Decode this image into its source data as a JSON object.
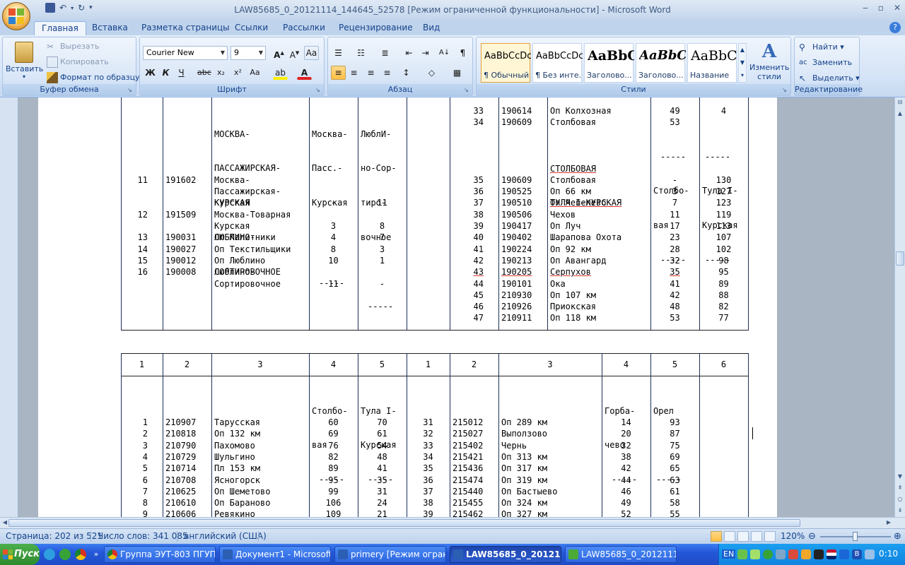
{
  "window": {
    "title": "LAW85685_0_20121114_144645_52578 [Режим ограниченной функциональности] - Microsoft Word"
  },
  "ribbon": {
    "tabs": [
      "Главная",
      "Вставка",
      "Разметка страницы",
      "Ссылки",
      "Рассылки",
      "Рецензирование",
      "Вид"
    ],
    "clipboard": {
      "paste": "Вставить",
      "cut": "Вырезать",
      "copy": "Копировать",
      "format_painter": "Формат по образцу",
      "label": "Буфер обмена"
    },
    "font": {
      "name": "Courier New",
      "size": "9",
      "label": "Шрифт"
    },
    "paragraph": {
      "label": "Абзац"
    },
    "styles": {
      "items": [
        {
          "sample": "AaBbCcDc",
          "name": "¶ Обычный"
        },
        {
          "sample": "AaBbCcDc",
          "name": "¶ Без инте..."
        },
        {
          "sample": "AaBbC",
          "name": "Заголово..."
        },
        {
          "sample": "AaBbCc",
          "name": "Заголово..."
        },
        {
          "sample": "AaBbC",
          "name": "Название"
        }
      ],
      "change": "Изменить стили",
      "label": "Стили"
    },
    "editing": {
      "find": "Найти",
      "replace": "Заменить",
      "select": "Выделить",
      "label": "Редактирование"
    }
  },
  "document": {
    "top_table": {
      "left_header": [
        "МОСКВА-",
        "ПАССАЖИРСКАЯ-",
        "КУРСКАЯ",
        "ЛЮБЛИНО-",
        "СОРТИРОВОЧНОЕ"
      ],
      "left_col4_header": [
        "Москва-",
        "Пасс.-",
        "Курская",
        "",
        "",
        "-----"
      ],
      "left_col5_header": [
        "ЛюблИ-",
        "но-Сор-",
        "тиро-",
        "вочное",
        "",
        "-----"
      ],
      "left_rows": [
        {
          "n": "11",
          "code": "191602",
          "name": [
            "Москва-",
            "Пассажирская-",
            "Курская"
          ],
          "c4": "-",
          "c5": "11"
        },
        {
          "n": "12",
          "code": "191509",
          "name": [
            "Москва-Товарная",
            "Курская"
          ],
          "c4": "3",
          "c5": "8"
        },
        {
          "n": "13",
          "code": "190031",
          "name": [
            "Оп Калитники"
          ],
          "c4": "4",
          "c5": "7"
        },
        {
          "n": "14",
          "code": "190027",
          "name": [
            "Оп Текстильщики"
          ],
          "c4": "8",
          "c5": "3"
        },
        {
          "n": "15",
          "code": "190012",
          "name": [
            "Оп Люблино"
          ],
          "c4": "10",
          "c5": "1"
        },
        {
          "n": "16",
          "code": "190008",
          "name": [
            "Люблино-",
            "Сортировочное"
          ],
          "c4": "11",
          "c5": "-"
        }
      ],
      "right_rows_top": [
        {
          "n": "33",
          "code": "190614",
          "name": "Оп Колхозная",
          "c4": "49",
          "c5": "4"
        },
        {
          "n": "34",
          "code": "190609",
          "name": "Столбовая",
          "c4": "53",
          "c5": ""
        }
      ],
      "right_section": {
        "title1": "СТОЛБОВАЯ",
        "title2": "ТУЛА I-КУРСКАЯ",
        "c4": [
          "-----",
          "Столбо-",
          "вая",
          "-----"
        ],
        "c5": [
          "-----",
          "Тула I-",
          "Курская",
          "-----"
        ]
      },
      "right_rows": [
        {
          "n": "35",
          "code": "190609",
          "name": "Столбовая",
          "c4": "-",
          "c5": "130"
        },
        {
          "n": "36",
          "code": "190525",
          "name": "Оп 66 км",
          "c4": "3",
          "c5": "127"
        },
        {
          "n": "37",
          "code": "190510",
          "name": "Оп Чепелево",
          "c4": "7",
          "c5": "123"
        },
        {
          "n": "38",
          "code": "190506",
          "name": "Чехов",
          "c4": "11",
          "c5": "119"
        },
        {
          "n": "39",
          "code": "190417",
          "name": "Оп Луч",
          "c4": "17",
          "c5": "113"
        },
        {
          "n": "40",
          "code": "190402",
          "name": "Шарапова Охота",
          "c4": "23",
          "c5": "107"
        },
        {
          "n": "41",
          "code": "190224",
          "name": "Оп 92 км",
          "c4": "28",
          "c5": "102"
        },
        {
          "n": "42",
          "code": "190213",
          "name": "Оп Авангард",
          "c4": "32",
          "c5": "98"
        },
        {
          "n": "43",
          "code": "190205",
          "name": "Серпухов",
          "c4": "35",
          "c5": "95"
        },
        {
          "n": "44",
          "code": "190101",
          "name": "Ока",
          "c4": "41",
          "c5": "89"
        },
        {
          "n": "45",
          "code": "210930",
          "name": "Оп 107 км",
          "c4": "42",
          "c5": "88"
        },
        {
          "n": "46",
          "code": "210926",
          "name": "Приокская",
          "c4": "48",
          "c5": "82"
        },
        {
          "n": "47",
          "code": "210911",
          "name": "Оп 118 км",
          "c4": "53",
          "c5": "77"
        }
      ]
    },
    "bottom_table": {
      "col_numbers": [
        "1",
        "2",
        "3",
        "4",
        "5",
        "1",
        "2",
        "3",
        "4",
        "5",
        "6"
      ],
      "left_c4_header": [
        "Столбо-",
        "вая",
        "-----"
      ],
      "left_c5_header": [
        "Тула I-",
        "Курская",
        "-----"
      ],
      "right_c4_header": [
        "Горба-",
        "чево",
        "-----"
      ],
      "right_c5_header": [
        "Орел",
        "",
        "-----"
      ],
      "left_rows": [
        {
          "n": "1",
          "code": "210907",
          "name": "Тарусская",
          "c4": "60",
          "c5": "70"
        },
        {
          "n": "2",
          "code": "210818",
          "name": "Оп 132 км",
          "c4": "69",
          "c5": "61"
        },
        {
          "n": "3",
          "code": "210790",
          "name": "Пахомово",
          "c4": "76",
          "c5": "54"
        },
        {
          "n": "4",
          "code": "210729",
          "name": "Шульгино",
          "c4": "82",
          "c5": "48"
        },
        {
          "n": "5",
          "code": "210714",
          "name": "Пл 153 км",
          "c4": "89",
          "c5": "41"
        },
        {
          "n": "6",
          "code": "210708",
          "name": "Ясногорск",
          "c4": "95",
          "c5": "35"
        },
        {
          "n": "7",
          "code": "210625",
          "name": "Оп Шеметово",
          "c4": "99",
          "c5": "31"
        },
        {
          "n": "8",
          "code": "210610",
          "name": "Оп Бараново",
          "c4": "106",
          "c5": "24"
        },
        {
          "n": "9",
          "code": "210606",
          "name": "Ревякино",
          "c4": "109",
          "c5": "21"
        }
      ],
      "right_rows": [
        {
          "n": "31",
          "code": "215012",
          "name": "Оп 289 км",
          "c4": "14",
          "c5": "93"
        },
        {
          "n": "32",
          "code": "215027",
          "name": "Выползово",
          "c4": "20",
          "c5": "87"
        },
        {
          "n": "33",
          "code": "215402",
          "name": "Чернь",
          "c4": "32",
          "c5": "75"
        },
        {
          "n": "34",
          "code": "215421",
          "name": "Оп 313 км",
          "c4": "38",
          "c5": "69"
        },
        {
          "n": "35",
          "code": "215436",
          "name": "Оп 317 км",
          "c4": "42",
          "c5": "65"
        },
        {
          "n": "36",
          "code": "215474",
          "name": "Оп 319 км",
          "c4": "44",
          "c5": "63"
        },
        {
          "n": "37",
          "code": "215440",
          "name": "Оп Бастыево",
          "c4": "46",
          "c5": "61"
        },
        {
          "n": "38",
          "code": "215455",
          "name": "Оп 324 км",
          "c4": "49",
          "c5": "58"
        },
        {
          "n": "39",
          "code": "215462",
          "name": "Оп 327 км",
          "c4": "52",
          "c5": "55"
        }
      ]
    }
  },
  "status": {
    "page": "Страница: 202 из 521",
    "words": "Число слов: 341 085",
    "language": "английский (США)",
    "zoom": "120%"
  },
  "taskbar": {
    "start": "Пуск",
    "tasks": [
      "Группа ЭУТ-803 ПГУПС...",
      "Документ1 - Microsoft ...",
      "primery [Режим огранич...",
      "LAW85685_0_201211...",
      "LAW85685_0_20121114..."
    ],
    "lang": "EN",
    "clock": "0:10"
  },
  "colors": {
    "ribbon": "#d4e3f6",
    "accent": "#15428b",
    "taskbar": "#2457d8",
    "start": "#2d8b2d"
  }
}
